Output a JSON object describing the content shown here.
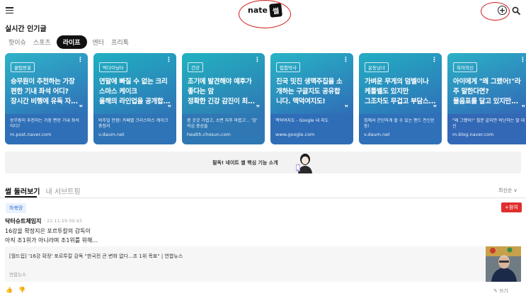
{
  "header": {
    "menu_icon": "hamburger-icon",
    "logo_word": "nate",
    "logo_badge": "썰",
    "plus_icon": "plus-circle-icon",
    "search_icon": "search-icon",
    "annotation_color": "#d31a1a"
  },
  "section_title": "실시간 인기글",
  "category_tabs": [
    {
      "label": "핫이슈",
      "active": false
    },
    {
      "label": "스포츠",
      "active": false
    },
    {
      "label": "라이프",
      "active": true
    },
    {
      "label": "엔터",
      "active": false
    },
    {
      "label": "프리톡",
      "active": false
    }
  ],
  "cards": [
    {
      "badge": "꿀팁방출",
      "headline": "승무원이 추천하는 가장\n편한 기내 좌석 어디?\n장시간 비행에 유독 자...",
      "desc": "승무원이 추천하는 가장 편한 기내 좌석 어디?",
      "source": "m.post.naver.com",
      "color_top": "#2eb3c8",
      "color_bottom": "#2f6fb7"
    },
    {
      "badge": "먹다이닝터",
      "headline": "연말에 빠질 수 없는 크리\n스마스 케이크\n올해의 라인업을 공개합...",
      "desc": "비주얼 만점! 카페별 크리스마스 케이크 총정리",
      "source": "v.daum.net",
      "color_top": "#1fb0c2",
      "color_bottom": "#2f74b6"
    },
    {
      "badge": "건강",
      "headline": "조기에 발견해야 예후가\n좋다는 암\n정확한 긴강 감진이 최...",
      "desc": "몸 곳곳 가렵고, 소변 자주 마렵고... '암' 의심 증상들",
      "source": "health.chosun.com",
      "color_top": "#22b2c0",
      "color_bottom": "#2f78b4"
    },
    {
      "badge": "험험박사",
      "headline": "진국 밋진 생맥주집을 소\n개하는 구글지도 공유합\n니다. 맥덕여지도!",
      "desc": "맥덕여지도 - Google 내 지도",
      "source": "www.google.com",
      "color_top": "#27b4c5",
      "color_bottom": "#2f6db7"
    },
    {
      "badge": "운동남녀",
      "headline": "가벼운 무게의 덤벨이나\n케틀벨도 있지만\n그조차도 무겁고 부담스...",
      "desc": "집에서 간단하게 할 수 있는 맨드 전신운동!",
      "source": "v.daum.net",
      "color_top": "#23aec3",
      "color_bottom": "#2f70b8"
    },
    {
      "badge": "육아의신",
      "headline": "아이에게 \"왜 그랬어!\"라\n주 말한다면?\n물음표를 달고 있지만...",
      "desc": "\"왜 그랬어!\" 필문 같지만 비난하는 말 대신",
      "source": "m.blog.naver.com",
      "color_top": "#2ab1c6",
      "color_bottom": "#3368b6"
    }
  ],
  "banner": {
    "text": "필독! 네이트 썰 핵심 기능 소개",
    "figure_icon": "girl-holding-phone-illustration"
  },
  "feed_tabs": [
    {
      "label": "썰 둘러보기",
      "active": true
    },
    {
      "label": "내 서브트핑",
      "active": false
    }
  ],
  "sort_label": "최신순 ∨",
  "post": {
    "category_badge": "하축망",
    "add_badge": "+참여",
    "author": "닥터슈트체임지",
    "date": "· 22.11.29 09:43",
    "line1": "16강을 확정지은 포르투칼의 감독이",
    "line2": "아직 조1위가 아니라며 조1위를 위해...",
    "link_title": "[월드컵] '16강 확정' 포르투칼 감독 \"한국전 큰 변화 없다...조 1위 목표\" | 연합뉴스",
    "link_source": "연합뉴스",
    "thumb_icon": "coach-photo-thumbnail",
    "like_icon": "thumbs-up-icon",
    "dislike_icon": "thumbs-down-icon",
    "write_label": "쓰기"
  }
}
